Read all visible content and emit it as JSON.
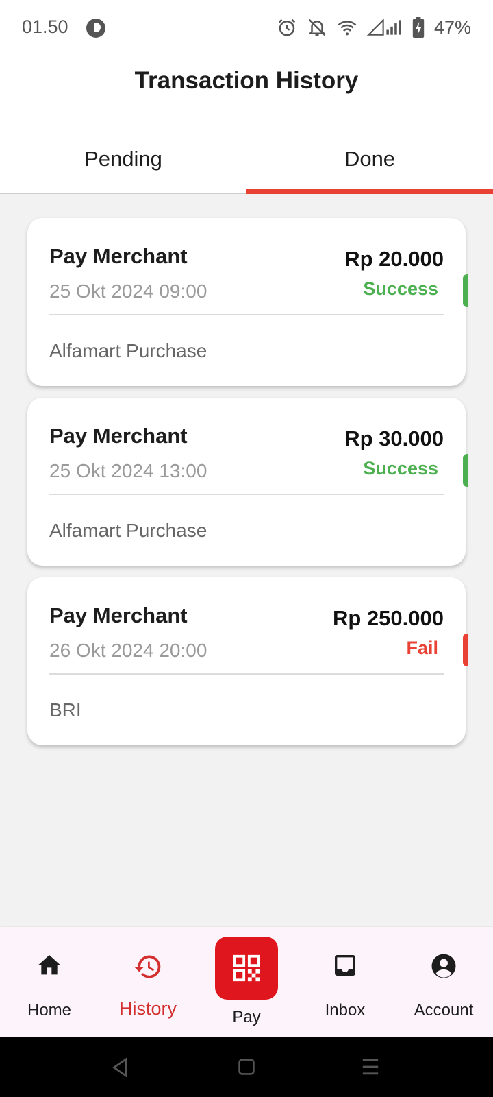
{
  "status_bar": {
    "time": "01.50",
    "battery": "47%"
  },
  "header": {
    "title": "Transaction History"
  },
  "tabs": [
    {
      "label": "Pending",
      "active": false
    },
    {
      "label": "Done",
      "active": true
    }
  ],
  "transactions": [
    {
      "type": "Pay Merchant",
      "date": "25 Okt 2024 09:00",
      "amount": "Rp 20.000",
      "status": "Success",
      "description": "Alfamart Purchase"
    },
    {
      "type": "Pay Merchant",
      "date": "25 Okt 2024 13:00",
      "amount": "Rp 30.000",
      "status": "Success",
      "description": "Alfamart Purchase"
    },
    {
      "type": "Pay Merchant",
      "date": "26 Okt 2024 20:00",
      "amount": "Rp 250.000",
      "status": "Fail",
      "description": "BRI"
    }
  ],
  "bottom_nav": [
    {
      "label": "Home",
      "icon": "home-icon",
      "active": false
    },
    {
      "label": "History",
      "icon": "history-icon",
      "active": true
    },
    {
      "label": "Pay",
      "icon": "qr-code-icon",
      "active": false
    },
    {
      "label": "Inbox",
      "icon": "inbox-icon",
      "active": false
    },
    {
      "label": "Account",
      "icon": "account-icon",
      "active": false
    }
  ],
  "colors": {
    "accent": "#e94234",
    "pay_button": "#e0161e",
    "success": "#4caf50",
    "fail": "#e94234",
    "active_nav": "#d32f2f"
  }
}
